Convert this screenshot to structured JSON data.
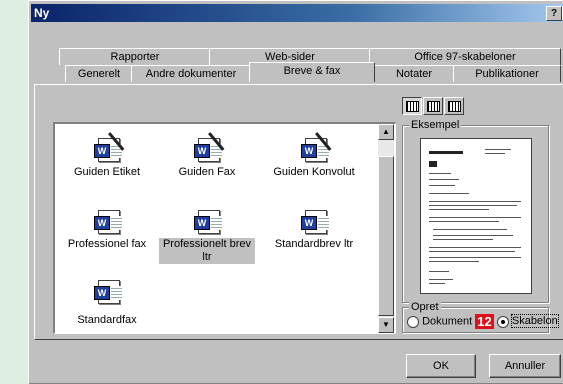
{
  "window": {
    "title": "Ny",
    "help_glyph": "?",
    "close_glyph": ""
  },
  "tabs_back": [
    "Rapporter",
    "Web-sider",
    "Office 97-skabeloner"
  ],
  "tabs_front": [
    "Generelt",
    "Andre dokumenter",
    "Breve & fax",
    "Notater",
    "Publikationer"
  ],
  "active_tab": "Breve & fax",
  "templates": [
    {
      "label": "Guiden Etiket",
      "kind": "wizard"
    },
    {
      "label": "Guiden Fax",
      "kind": "wizard"
    },
    {
      "label": "Guiden Konvolut",
      "kind": "wizard"
    },
    {
      "label": "Professionel fax",
      "kind": "document"
    },
    {
      "label": "Professionelt brev ltr",
      "kind": "document",
      "selected": true
    },
    {
      "label": "Standardbrev ltr",
      "kind": "document"
    },
    {
      "label": "Standardfax",
      "kind": "document"
    }
  ],
  "preview": {
    "group_label": "Eksempel"
  },
  "create": {
    "group_label": "Opret",
    "option_document": "Dokument",
    "option_template": "Skabelon",
    "selected": "Skabelon",
    "step_badge": "12"
  },
  "buttons": {
    "ok": "OK",
    "cancel": "Annuller"
  },
  "colors": {
    "badge": "#e0101a",
    "title_start": "#0a246a",
    "title_end": "#a6caf0"
  }
}
